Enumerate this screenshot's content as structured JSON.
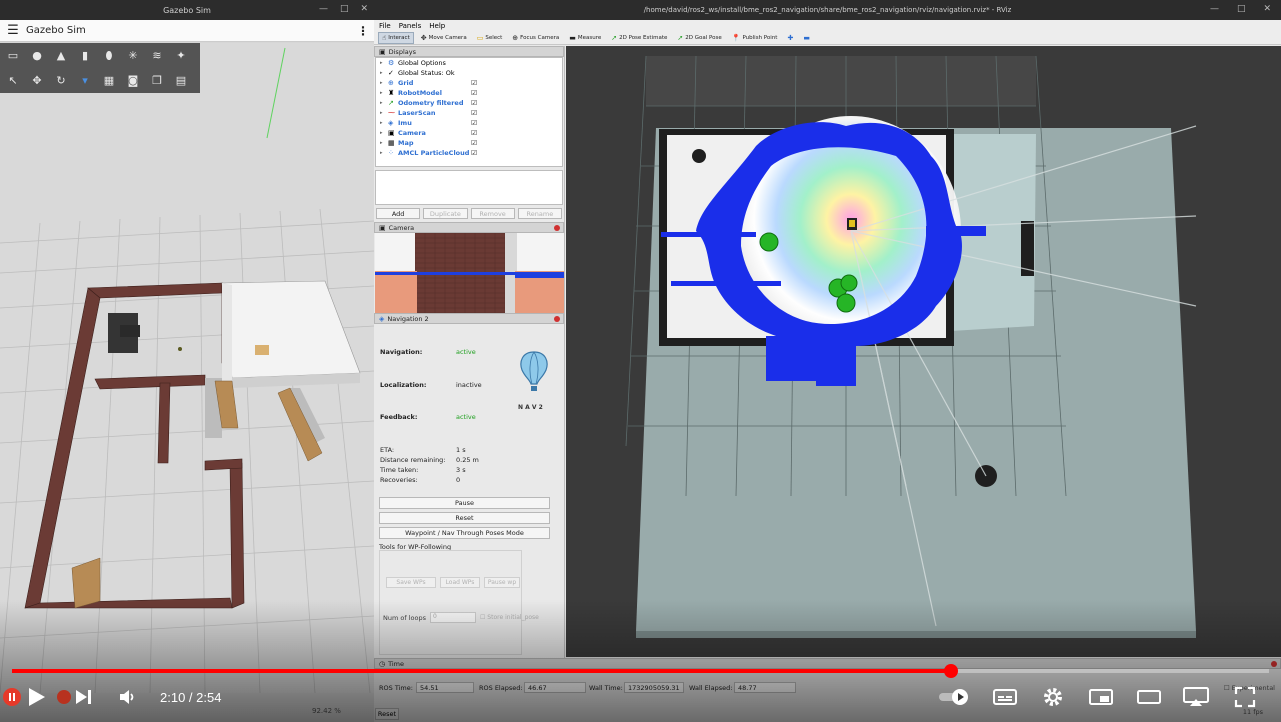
{
  "gazebo": {
    "window_title": "Gazebo Sim",
    "app_title": "Gazebo Sim",
    "zoom_text": "92.42 %"
  },
  "rviz": {
    "window_title": "/home/david/ros2_ws/install/bme_ros2_navigation/share/bme_ros2_navigation/rviz/navigation.rviz* - RViz",
    "menu": [
      "File",
      "Panels",
      "Help"
    ],
    "tools": [
      {
        "label": "Interact",
        "icon": "interact-icon"
      },
      {
        "label": "Move Camera",
        "icon": "move-camera-icon"
      },
      {
        "label": "Select",
        "icon": "select-icon"
      },
      {
        "label": "Focus Camera",
        "icon": "focus-camera-icon"
      },
      {
        "label": "Measure",
        "icon": "measure-icon"
      },
      {
        "label": "2D Pose Estimate",
        "icon": "pose-estimate-icon"
      },
      {
        "label": "2D Goal Pose",
        "icon": "goal-pose-icon"
      },
      {
        "label": "Publish Point",
        "icon": "publish-point-icon"
      }
    ],
    "displays": {
      "title": "Displays",
      "items": [
        {
          "label": "Global Options",
          "checked": false
        },
        {
          "label": "Global Status: Ok",
          "checked": false
        },
        {
          "label": "Grid",
          "checked": true
        },
        {
          "label": "RobotModel",
          "checked": true
        },
        {
          "label": "Odometry filtered",
          "checked": true
        },
        {
          "label": "LaserScan",
          "checked": true
        },
        {
          "label": "Imu",
          "checked": true
        },
        {
          "label": "Camera",
          "checked": true
        },
        {
          "label": "Map",
          "checked": true
        },
        {
          "label": "AMCL ParticleCloud",
          "checked": true
        }
      ],
      "buttons": [
        "Add",
        "Duplicate",
        "Remove",
        "Rename"
      ]
    },
    "camera_panel": {
      "title": "Camera"
    },
    "nav2": {
      "title": "Navigation 2",
      "navigation_label": "Navigation:",
      "navigation_value": "active",
      "localization_label": "Localization:",
      "localization_value": "inactive",
      "feedback_label": "Feedback:",
      "feedback_value": "active",
      "logo_text": "N A V 2",
      "eta_label": "ETA:",
      "eta_value": "1 s",
      "distance_label": "Distance remaining:",
      "distance_value": "0.25 m",
      "time_taken_label": "Time taken:",
      "time_taken_value": "3 s",
      "recoveries_label": "Recoveries:",
      "recoveries_value": "0",
      "pause_button": "Pause",
      "reset_button": "Reset",
      "waypoint_button": "Waypoint / Nav Through Poses Mode",
      "wp_tools_label": "Tools for WP-Following",
      "save_wps": "Save WPs",
      "load_wps": "Load WPs",
      "pause_wp": "Pause wp",
      "loops_label": "Num of loops",
      "loops_value": "0",
      "store_initial_pose": "Store initial_pose"
    },
    "time_panel": {
      "title": "Time",
      "ros_time_label": "ROS Time:",
      "ros_time": "54.51",
      "ros_elapsed_label": "ROS Elapsed:",
      "ros_elapsed": "46.67",
      "wall_time_label": "Wall Time:",
      "wall_time": "1732905059.31",
      "wall_elapsed_label": "Wall Elapsed:",
      "wall_elapsed": "48.77",
      "experimental": "Experimental",
      "reset": "Reset",
      "fps": "11 fps"
    }
  },
  "player": {
    "time_display": "2:10 / 2:54",
    "progress_fraction": 0.747,
    "accent": "#ff0000"
  }
}
